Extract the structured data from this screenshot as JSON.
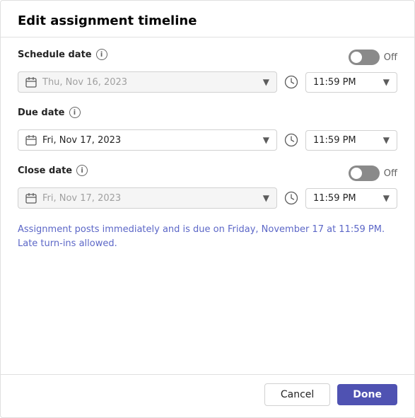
{
  "dialog": {
    "title": "Edit assignment timeline"
  },
  "schedule_date": {
    "label": "Schedule date",
    "info_label": "i",
    "toggle_state": "Off",
    "date_placeholder": "Thu, Nov 16, 2023",
    "disabled": true,
    "time_value": "11:59 PM"
  },
  "due_date": {
    "label": "Due date",
    "info_label": "i",
    "date_value": "Fri, Nov 17, 2023",
    "disabled": false,
    "time_value": "11:59 PM"
  },
  "close_date": {
    "label": "Close date",
    "info_label": "i",
    "toggle_state": "Off",
    "date_placeholder": "Fri, Nov 17, 2023",
    "disabled": true,
    "time_value": "11:59 PM"
  },
  "info_text": "Assignment posts immediately and is due on Friday, November 17 at 11:59 PM. Late turn-ins allowed.",
  "footer": {
    "cancel_label": "Cancel",
    "done_label": "Done"
  }
}
